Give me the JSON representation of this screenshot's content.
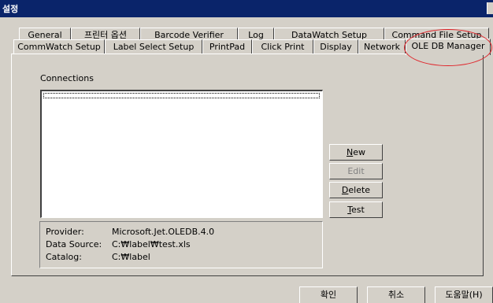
{
  "window": {
    "title": "설정"
  },
  "tabs_row1": [
    {
      "label": "General"
    },
    {
      "label": "프린터 옵션"
    },
    {
      "label": "Barcode Verifier"
    },
    {
      "label": "Log"
    },
    {
      "label": "DataWatch Setup"
    },
    {
      "label": "Command File Setup"
    }
  ],
  "tabs_row2": [
    {
      "label": "CommWatch Setup"
    },
    {
      "label": "Label Select Setup"
    },
    {
      "label": "PrintPad"
    },
    {
      "label": "Click Print"
    },
    {
      "label": "Display"
    },
    {
      "label": "Network"
    },
    {
      "label": "OLE DB Manager",
      "active": true
    }
  ],
  "connections": {
    "label": "Connections",
    "items": []
  },
  "buttons": {
    "new": {
      "accel": "N",
      "rest": "ew"
    },
    "edit": {
      "label": "Edit"
    },
    "delete": {
      "accel": "D",
      "rest": "elete"
    },
    "test": {
      "accel": "T",
      "rest": "est"
    }
  },
  "info": {
    "provider_label": "Provider:",
    "provider_value": "Microsoft.Jet.OLEDB.4.0",
    "datasource_label": "Data Source:",
    "datasource_value": "C:₩label₩test.xls",
    "catalog_label": "Catalog:",
    "catalog_value": "C:₩label"
  },
  "dialog_buttons": {
    "ok": "확인",
    "cancel": "취소",
    "help": "도움말(H)"
  },
  "colors": {
    "face": "#d4d0c8",
    "titlebar": "#0a246a",
    "annotation": "#e0242a"
  }
}
